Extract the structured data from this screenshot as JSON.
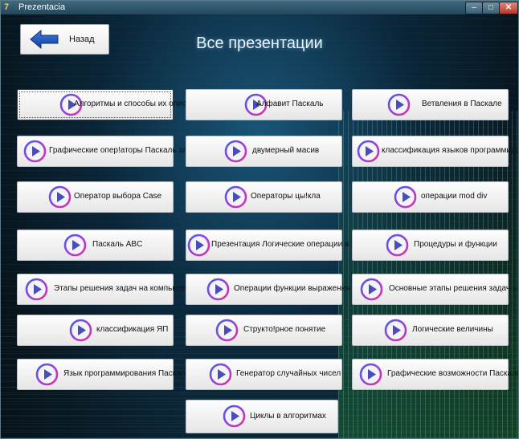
{
  "window": {
    "title": "Prezentacia"
  },
  "titlebar": {
    "min": "–",
    "max": "□",
    "close": "✕",
    "app_icon": "7"
  },
  "back_button": {
    "label": "Назад"
  },
  "page_title": "Все презентации",
  "presentations": [
    "Алгоритмы и способы их описания",
    "Алфавит Паскаль",
    "Ветвления в Паскале",
    "Графические опер!аторы Паскаль задачи",
    "двумерный масив",
    "классификация языков программирования",
    "Оператор выбора Case",
    "Операторы цы!кла",
    "операции mod div",
    "Паскаль ABC",
    "Презентация Логические операции в Паскале",
    "Процедуры и функции",
    "Этапы решения задач на компьютере",
    "Операции функции выражения",
    "Основные этапы решения задач на ЭВМ",
    "классификация ЯП",
    "Структо!рное понятие",
    "Логические величины",
    "Язык программирования Паскаль",
    "Генератор случайных чисел",
    "Графические возможности Паскаль ABC",
    "Циклы в алгоритмах"
  ]
}
